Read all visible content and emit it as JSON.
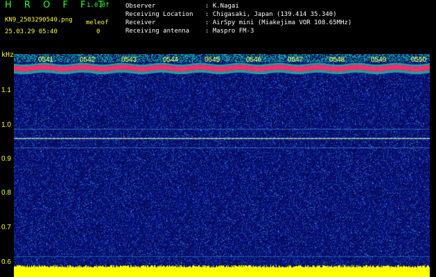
{
  "header": {
    "app_title": "H R O F F T",
    "version": "1.0.0f",
    "filename": "KN9_2503290540.png",
    "meleof_label": "meleof",
    "timestamp": "25.03.29 05:40",
    "meleof_value": "0"
  },
  "metadata": [
    {
      "key": "Observer",
      "value": ": K.Nagai"
    },
    {
      "key": "Receiving Location",
      "value": ": Chigasaki, Japan (139.414 35.340)"
    },
    {
      "key": "Receiver",
      "value": ": AirSpy mini (Miakejima VOR 108.65MHz)"
    },
    {
      "key": "Receiving antenna",
      "value": ": Maspro FM-3"
    }
  ],
  "axis": {
    "unit": "kHz",
    "y_ticks": [
      "1.1",
      "1.0",
      "0.9",
      "0.8",
      "0.7",
      "0.6"
    ],
    "x_ticks": [
      "0541",
      "0542",
      "0543",
      "0544",
      "0545",
      "0546",
      "0547",
      "0548",
      "0549",
      "0550"
    ]
  },
  "colors": {
    "background": "#000000",
    "header_green": "#2cff2c",
    "axis_yellow": "#ffff3c",
    "noise_blue": "#0a1a8c",
    "carrier": "#ff2a6a"
  }
}
